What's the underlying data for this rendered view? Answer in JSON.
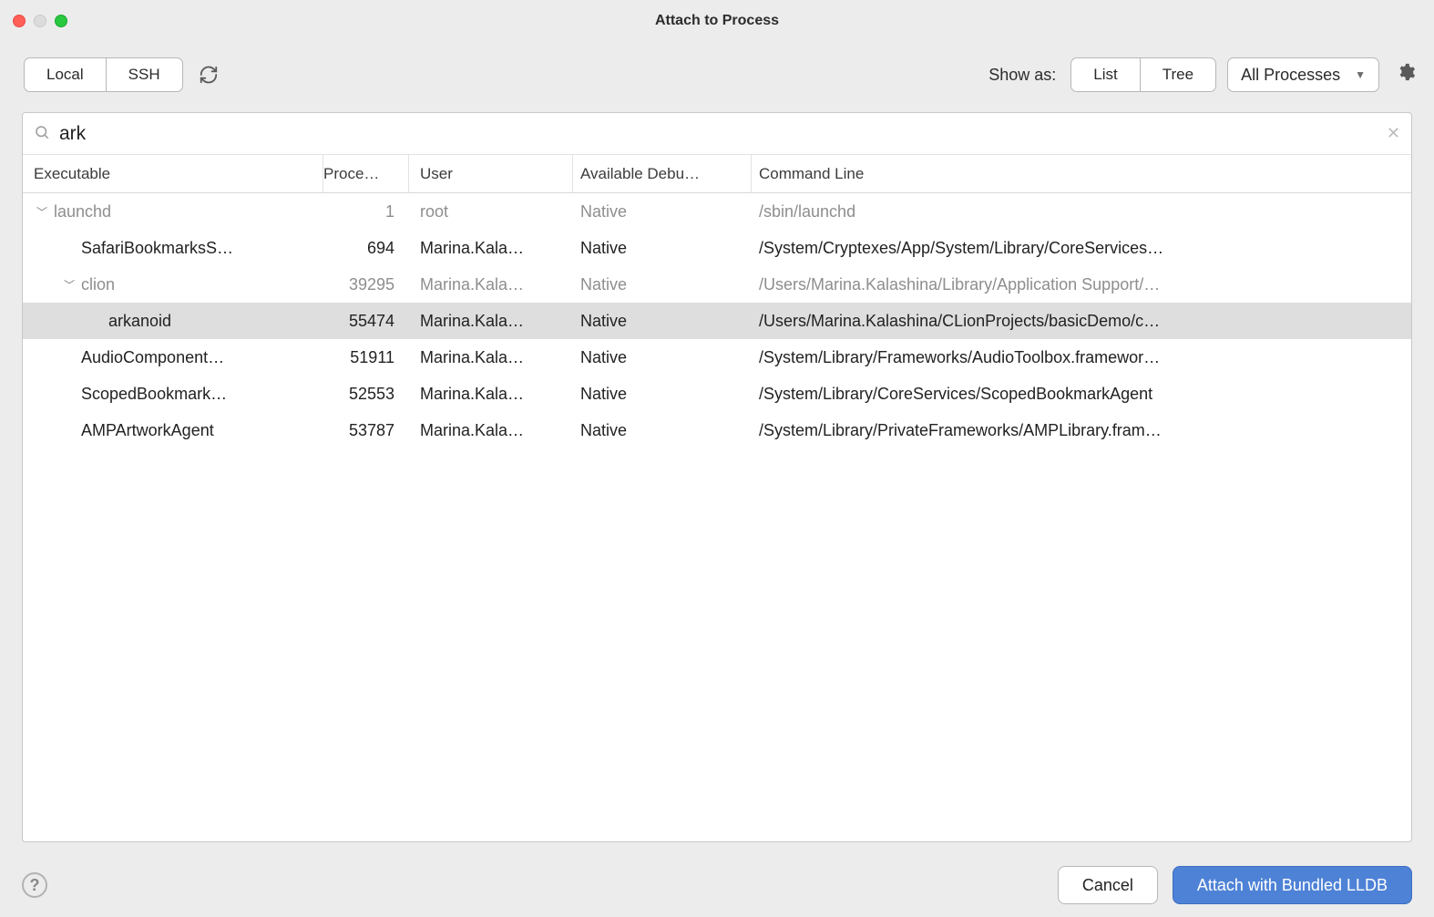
{
  "window": {
    "title": "Attach to Process"
  },
  "toolbar": {
    "local_label": "Local",
    "ssh_label": "SSH",
    "showas_label": "Show as:",
    "list_label": "List",
    "tree_label": "Tree",
    "filter_label": "All Processes"
  },
  "search": {
    "value": "ark"
  },
  "columns": {
    "executable": "Executable",
    "pid": "Proce…",
    "user": "User",
    "debuggers": "Available Debu…",
    "cmd": "Command Line"
  },
  "rows": [
    {
      "indent": 0,
      "disclosure": true,
      "dim": true,
      "sel": false,
      "exe": "launchd",
      "pid": "1",
      "user": "root",
      "dbg": "Native",
      "cmd": "/sbin/launchd"
    },
    {
      "indent": 1,
      "disclosure": false,
      "dim": false,
      "sel": false,
      "exe": "SafariBookmarksS…",
      "pid": "694",
      "user": "Marina.Kala…",
      "dbg": "Native",
      "cmd": "/System/Cryptexes/App/System/Library/CoreServices…"
    },
    {
      "indent": 1,
      "disclosure": true,
      "dim": true,
      "sel": false,
      "exe": "clion",
      "pid": "39295",
      "user": "Marina.Kala…",
      "dbg": "Native",
      "cmd": "/Users/Marina.Kalashina/Library/Application Support/…"
    },
    {
      "indent": 2,
      "disclosure": false,
      "dim": false,
      "sel": true,
      "exe": "arkanoid",
      "pid": "55474",
      "user": "Marina.Kala…",
      "dbg": "Native",
      "cmd": "/Users/Marina.Kalashina/CLionProjects/basicDemo/c…"
    },
    {
      "indent": 1,
      "disclosure": false,
      "dim": false,
      "sel": false,
      "exe": "AudioComponent…",
      "pid": "51911",
      "user": "Marina.Kala…",
      "dbg": "Native",
      "cmd": "/System/Library/Frameworks/AudioToolbox.framewor…"
    },
    {
      "indent": 1,
      "disclosure": false,
      "dim": false,
      "sel": false,
      "exe": "ScopedBookmark…",
      "pid": "52553",
      "user": "Marina.Kala…",
      "dbg": "Native",
      "cmd": "/System/Library/CoreServices/ScopedBookmarkAgent"
    },
    {
      "indent": 1,
      "disclosure": false,
      "dim": false,
      "sel": false,
      "exe": "AMPArtworkAgent",
      "pid": "53787",
      "user": "Marina.Kala…",
      "dbg": "Native",
      "cmd": "/System/Library/PrivateFrameworks/AMPLibrary.fram…"
    }
  ],
  "footer": {
    "cancel": "Cancel",
    "attach": "Attach with Bundled LLDB"
  }
}
